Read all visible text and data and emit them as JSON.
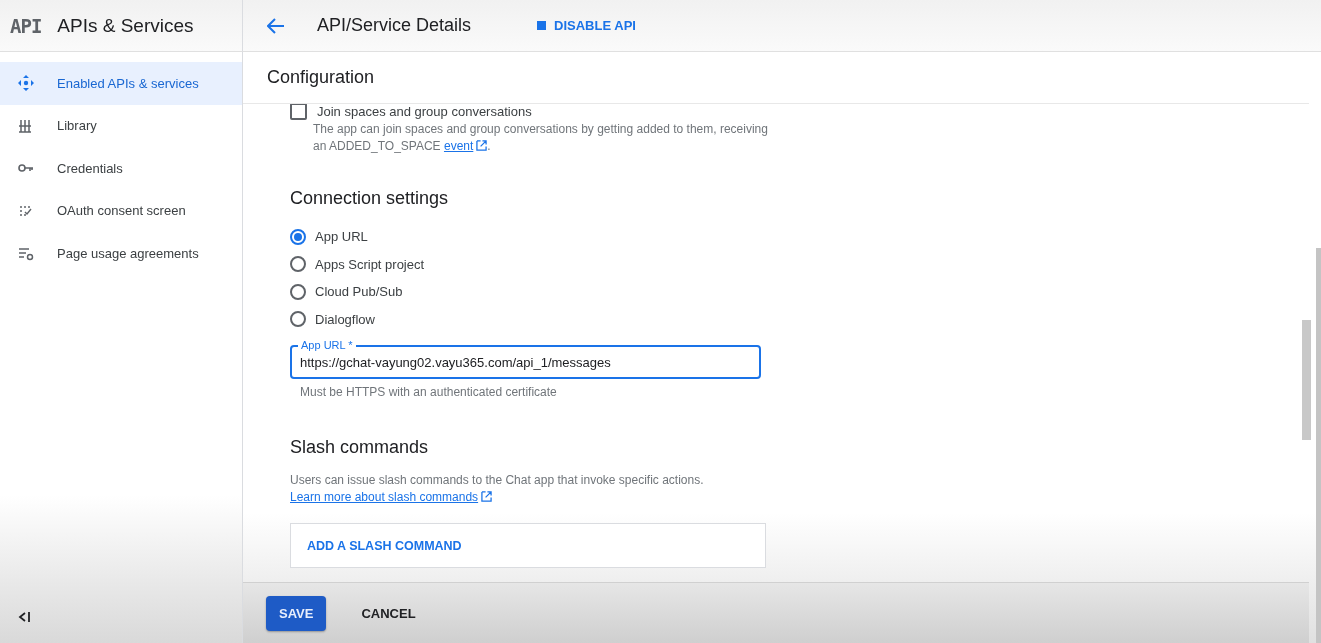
{
  "app": {
    "logo": "API",
    "title": "APIs & Services"
  },
  "header": {
    "title": "API/Service Details",
    "action": "DISABLE API"
  },
  "sidebar": {
    "items": [
      {
        "label": "Enabled APIs & services",
        "selected": true
      },
      {
        "label": "Library",
        "selected": false
      },
      {
        "label": "Credentials",
        "selected": false
      },
      {
        "label": "OAuth consent screen",
        "selected": false
      },
      {
        "label": "Page usage agreements",
        "selected": false
      }
    ]
  },
  "section_title": "Configuration",
  "join_option": {
    "label": "Join spaces and group conversations",
    "checked": false,
    "description": "The app can join spaces and group conversations by getting added to them, receiving an ADDED_TO_SPACE",
    "link": "event",
    "after": "."
  },
  "connection": {
    "title": "Connection settings",
    "options": [
      {
        "label": "App URL",
        "selected": true
      },
      {
        "label": "Apps Script project",
        "selected": false
      },
      {
        "label": "Cloud Pub/Sub",
        "selected": false
      },
      {
        "label": "Dialogflow",
        "selected": false
      }
    ],
    "field": {
      "label": "App URL *",
      "value": "https://gchat-vayung02.vayu365.com/api_1/messages",
      "focused": true,
      "helper": "Must be HTTPS with an authenticated certificate"
    }
  },
  "slash": {
    "title": "Slash commands",
    "description": "Users can issue slash commands to the Chat app that invoke specific actions.",
    "link": "Learn more about slash commands",
    "button": "ADD A SLASH COMMAND"
  },
  "footer": {
    "buttons": [
      {
        "label": "SAVE",
        "kind": "primary"
      },
      {
        "label": "CANCEL",
        "kind": "text"
      }
    ]
  }
}
